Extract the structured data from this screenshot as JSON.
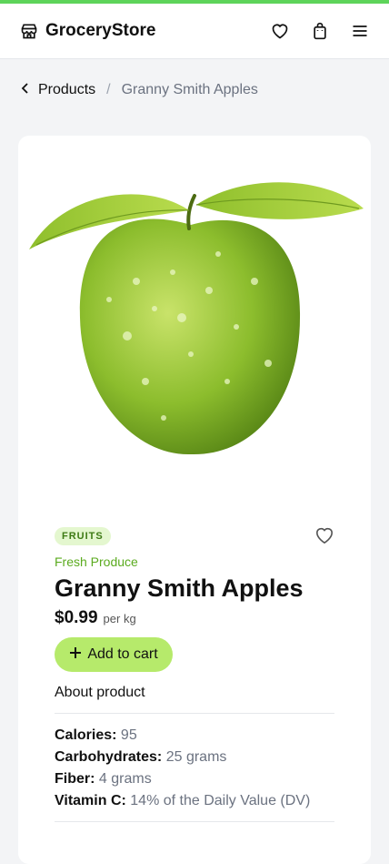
{
  "header": {
    "brand": "GroceryStore",
    "icons": [
      "store-icon",
      "heart-icon",
      "shopping-bag-icon",
      "menu-icon"
    ]
  },
  "breadcrumb": {
    "parent": "Products",
    "separator": "/",
    "current": "Granny Smith Apples"
  },
  "product": {
    "badge": "FRUITS",
    "category": "Fresh Produce",
    "name": "Granny Smith Apples",
    "price": "$0.99",
    "unit": "per kg",
    "add_label": "Add to cart",
    "about_label": "About product",
    "nutrition": [
      {
        "label": "Calories:",
        "value": "95"
      },
      {
        "label": "Carbohydrates:",
        "value": "25 grams"
      },
      {
        "label": "Fiber:",
        "value": "4 grams"
      },
      {
        "label": "Vitamin C:",
        "value": "14% of the Daily Value (DV)"
      }
    ]
  },
  "colors": {
    "accent": "#b6ea6b",
    "top_bar": "#5ed45a",
    "category_text": "#5bab1f"
  }
}
